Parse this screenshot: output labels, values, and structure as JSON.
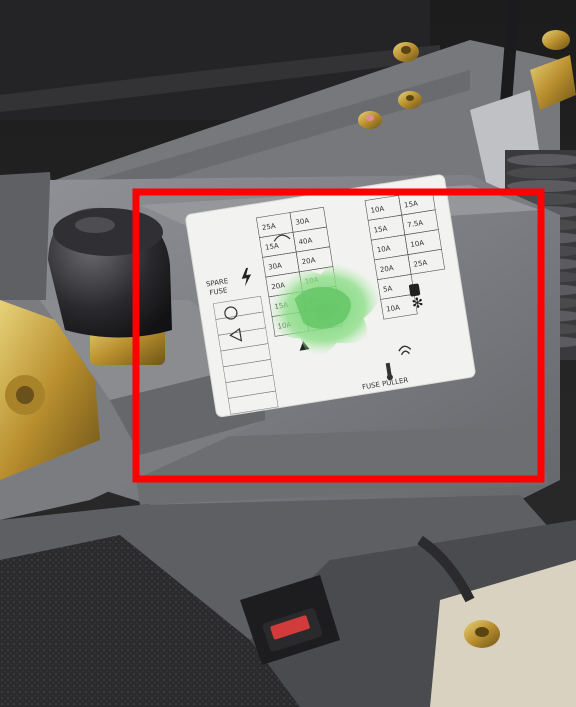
{
  "photo": {
    "subject": "vehicle fuse box cover with fuse label",
    "highlight_color": "#ff0000",
    "smudge_color": "#6fd16f"
  },
  "fuse_label": {
    "header_lines": [
      "SPARE",
      "FUSE"
    ],
    "amp_cells": [
      "25A",
      "15A",
      "30A",
      "20A",
      "15A",
      "10A",
      "30A",
      "40A",
      "20A",
      "10A",
      "30A",
      "15A",
      "10A",
      "15A",
      "10A",
      "20A",
      "5A",
      "10A",
      "15A",
      "7.5A",
      "10A",
      "25A"
    ],
    "bottom_text": "FUSE PULLER",
    "icons": [
      "lightning-icon",
      "headlight-icon",
      "fan-icon",
      "horn-icon",
      "wiper-icon",
      "hazard-icon",
      "radio-icon",
      "seat-heater-icon",
      "thermometer-icon"
    ]
  }
}
